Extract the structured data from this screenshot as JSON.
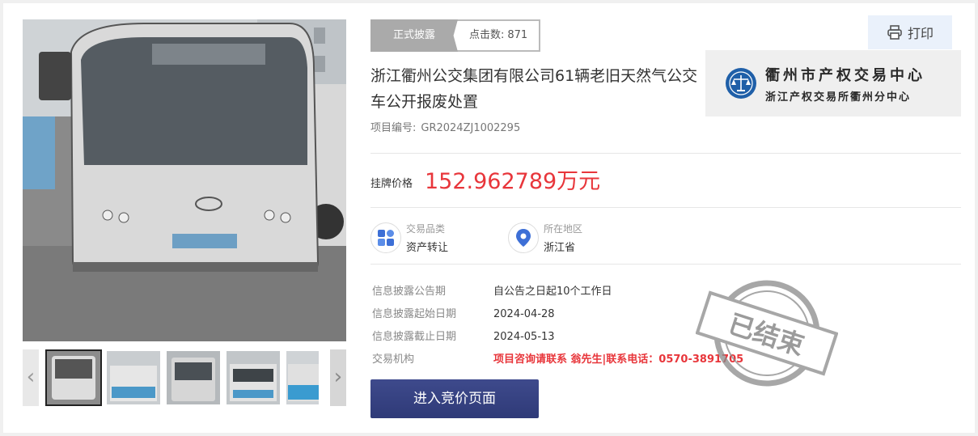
{
  "status": {
    "formal_label": "正式披露",
    "clicks_label": "点击数:",
    "clicks_value": "871"
  },
  "print": {
    "label": "打印"
  },
  "logo": {
    "line1": "衢州市产权交易中心",
    "line2": "浙江产权交易所衢州分中心"
  },
  "project": {
    "title": "浙江衢州公交集团有限公司61辆老旧天然气公交车公开报废处置",
    "number_label": "项目编号:",
    "number_value": "GR2024ZJ1002295"
  },
  "price": {
    "label": "挂牌价格",
    "value": "152.962789万元"
  },
  "meta": [
    {
      "key": "交易品类",
      "value": "资产转让",
      "icon": "category-grid-icon"
    },
    {
      "key": "所在地区",
      "value": "浙江省",
      "icon": "location-pin-icon"
    }
  ],
  "details": [
    {
      "key": "信息披露公告期",
      "value": "自公告之日起10个工作日"
    },
    {
      "key": "信息披露起始日期",
      "value": "2024-04-28"
    },
    {
      "key": "信息披露截止日期",
      "value": "2024-05-13"
    },
    {
      "key": "交易机构",
      "value": "项目咨询请联系 翁先生|联系电话：0570-3891705"
    }
  ],
  "stamp": {
    "text": "已结束"
  },
  "bid_button": {
    "label": "进入竞价页面"
  },
  "gallery": {
    "prev_icon": "chevron-left-icon",
    "next_icon": "chevron-right-icon",
    "thumb_count": 5,
    "active_index": 0
  },
  "colors": {
    "price_red": "#e8363b",
    "button_navy": "#2f3a78",
    "print_bg": "#eaf1fb"
  }
}
